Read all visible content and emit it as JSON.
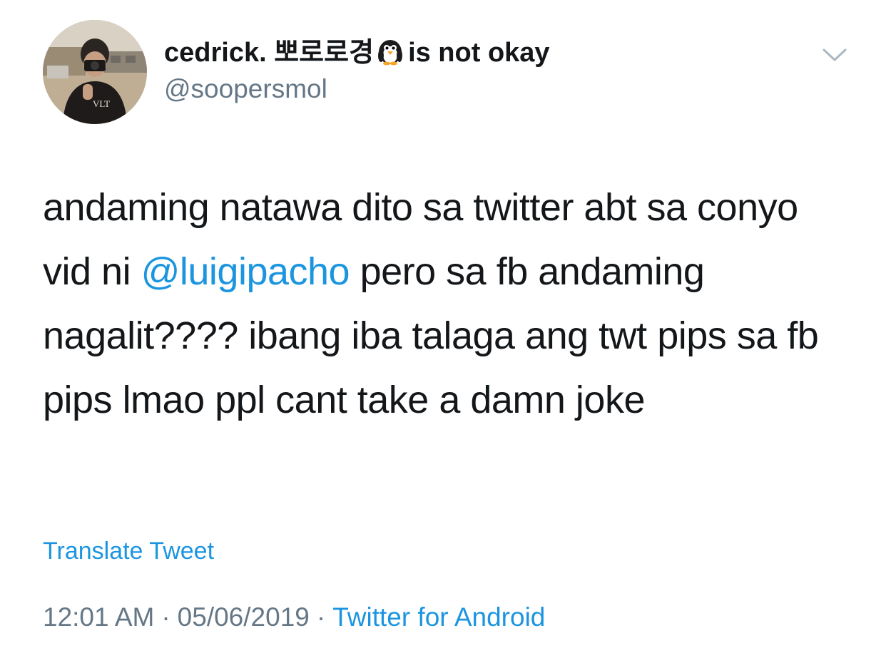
{
  "tweet": {
    "display_name": "cedrick. 뽀로로경",
    "display_name_suffix": "is not okay",
    "name_emoji": "penguin-emoji",
    "handle": "@soopersmol",
    "text": {
      "part1": "andaming natawa dito sa twitter abt sa conyo vid ni ",
      "mention": "@luigipacho",
      "part2": " pero sa fb andaming nagalit???? ibang iba talaga ang twt pips sa fb pips lmao ppl cant take a damn joke"
    },
    "translate_label": "Translate Tweet",
    "time": "12:01 AM",
    "date": "05/06/2019",
    "separator": "·",
    "source": "Twitter for Android",
    "avatar_shirt_text": "VLT"
  },
  "colors": {
    "text": "#14171a",
    "secondary": "#657786",
    "link": "#1b95e0",
    "chevron": "#aab8c2"
  }
}
